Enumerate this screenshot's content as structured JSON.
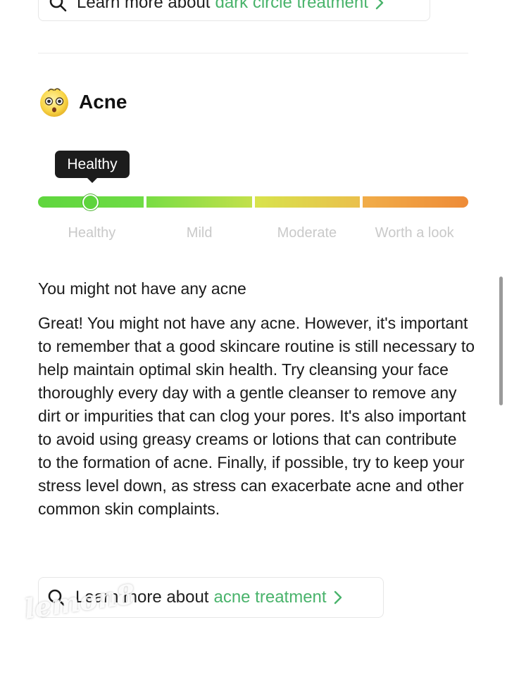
{
  "top_button": {
    "lead": "Learn more about",
    "accent": "dark circle treatment",
    "search_icon": "search-icon",
    "chevron_icon": "chevron-right-icon"
  },
  "section": {
    "title": "Acne",
    "icon": "shocked-face-emoji-icon"
  },
  "scale": {
    "tooltip": "Healthy",
    "current_level": "Healthy",
    "labels": [
      "Healthy",
      "Mild",
      "Moderate",
      "Worth a look"
    ],
    "colors": [
      "#5fd63e",
      "#a8df48",
      "#e2cf4b",
      "#ee8b37"
    ]
  },
  "result": {
    "title": "You might not have any acne",
    "body": "Great! You might not have any acne. However, it's important to remember that a good skincare routine is still necessary to help maintain optimal skin health. Try cleansing your face thoroughly every day with a gentle cleanser to remove any dirt or impurities that can clog your pores. It's also important to avoid using greasy creams or lotions that can contribute to the formation of acne. Finally, if possible, try to keep your stress level down, as stress can exacerbate acne and other common skin complaints."
  },
  "bottom_button": {
    "lead": "Learn more about",
    "accent": "acne treatment",
    "search_icon": "search-icon",
    "chevron_icon": "chevron-right-icon"
  },
  "watermark": "lemon8",
  "colors": {
    "accent": "#49b36b",
    "tooltip_bg": "#1c1c1c"
  }
}
